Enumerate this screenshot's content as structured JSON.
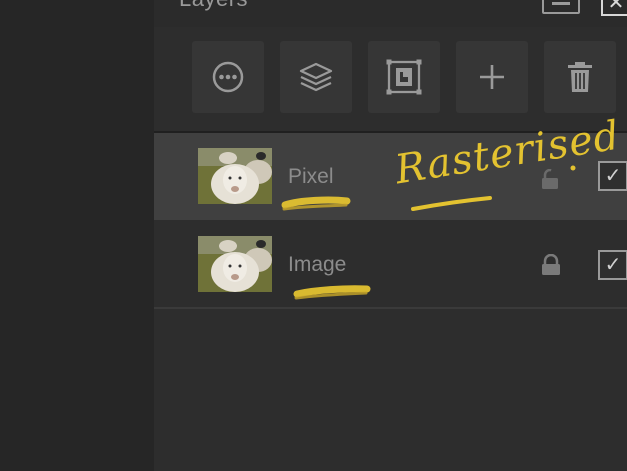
{
  "panel": {
    "title": "Layers"
  },
  "toolbar": {
    "buttons": [
      {
        "icon": "more-options-icon"
      },
      {
        "icon": "layer-stack-icon"
      },
      {
        "icon": "mask-icon"
      },
      {
        "icon": "add-icon"
      },
      {
        "icon": "trash-icon"
      }
    ]
  },
  "layers": [
    {
      "name": "Pixel",
      "selected": true,
      "locked": false,
      "visible_checked": true
    },
    {
      "name": "Image",
      "selected": false,
      "locked": true,
      "visible_checked": true
    }
  ],
  "annotation": {
    "text": "Rasterised",
    "color": "#e3c230"
  },
  "colors": {
    "panel_bg": "#2d2d2d",
    "selected_row": "#404040",
    "highlight": "#e3c230"
  }
}
